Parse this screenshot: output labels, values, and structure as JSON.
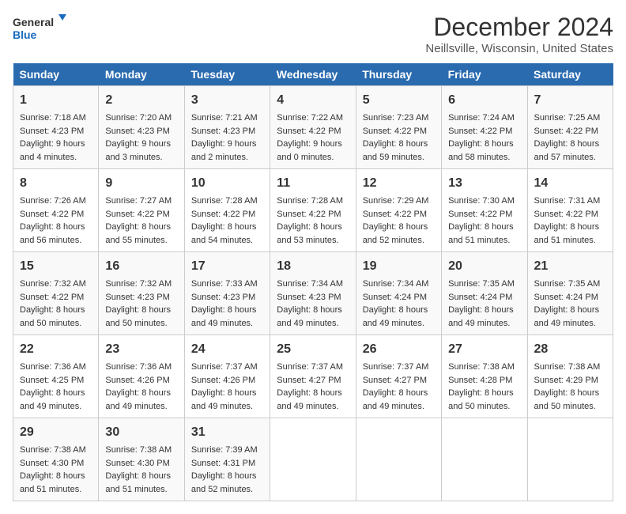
{
  "logo": {
    "line1": "General",
    "line2": "Blue"
  },
  "title": "December 2024",
  "subtitle": "Neillsville, Wisconsin, United States",
  "days_of_week": [
    "Sunday",
    "Monday",
    "Tuesday",
    "Wednesday",
    "Thursday",
    "Friday",
    "Saturday"
  ],
  "weeks": [
    [
      {
        "day": "1",
        "sunrise": "Sunrise: 7:18 AM",
        "sunset": "Sunset: 4:23 PM",
        "daylight": "Daylight: 9 hours and 4 minutes."
      },
      {
        "day": "2",
        "sunrise": "Sunrise: 7:20 AM",
        "sunset": "Sunset: 4:23 PM",
        "daylight": "Daylight: 9 hours and 3 minutes."
      },
      {
        "day": "3",
        "sunrise": "Sunrise: 7:21 AM",
        "sunset": "Sunset: 4:23 PM",
        "daylight": "Daylight: 9 hours and 2 minutes."
      },
      {
        "day": "4",
        "sunrise": "Sunrise: 7:22 AM",
        "sunset": "Sunset: 4:22 PM",
        "daylight": "Daylight: 9 hours and 0 minutes."
      },
      {
        "day": "5",
        "sunrise": "Sunrise: 7:23 AM",
        "sunset": "Sunset: 4:22 PM",
        "daylight": "Daylight: 8 hours and 59 minutes."
      },
      {
        "day": "6",
        "sunrise": "Sunrise: 7:24 AM",
        "sunset": "Sunset: 4:22 PM",
        "daylight": "Daylight: 8 hours and 58 minutes."
      },
      {
        "day": "7",
        "sunrise": "Sunrise: 7:25 AM",
        "sunset": "Sunset: 4:22 PM",
        "daylight": "Daylight: 8 hours and 57 minutes."
      }
    ],
    [
      {
        "day": "8",
        "sunrise": "Sunrise: 7:26 AM",
        "sunset": "Sunset: 4:22 PM",
        "daylight": "Daylight: 8 hours and 56 minutes."
      },
      {
        "day": "9",
        "sunrise": "Sunrise: 7:27 AM",
        "sunset": "Sunset: 4:22 PM",
        "daylight": "Daylight: 8 hours and 55 minutes."
      },
      {
        "day": "10",
        "sunrise": "Sunrise: 7:28 AM",
        "sunset": "Sunset: 4:22 PM",
        "daylight": "Daylight: 8 hours and 54 minutes."
      },
      {
        "day": "11",
        "sunrise": "Sunrise: 7:28 AM",
        "sunset": "Sunset: 4:22 PM",
        "daylight": "Daylight: 8 hours and 53 minutes."
      },
      {
        "day": "12",
        "sunrise": "Sunrise: 7:29 AM",
        "sunset": "Sunset: 4:22 PM",
        "daylight": "Daylight: 8 hours and 52 minutes."
      },
      {
        "day": "13",
        "sunrise": "Sunrise: 7:30 AM",
        "sunset": "Sunset: 4:22 PM",
        "daylight": "Daylight: 8 hours and 51 minutes."
      },
      {
        "day": "14",
        "sunrise": "Sunrise: 7:31 AM",
        "sunset": "Sunset: 4:22 PM",
        "daylight": "Daylight: 8 hours and 51 minutes."
      }
    ],
    [
      {
        "day": "15",
        "sunrise": "Sunrise: 7:32 AM",
        "sunset": "Sunset: 4:22 PM",
        "daylight": "Daylight: 8 hours and 50 minutes."
      },
      {
        "day": "16",
        "sunrise": "Sunrise: 7:32 AM",
        "sunset": "Sunset: 4:23 PM",
        "daylight": "Daylight: 8 hours and 50 minutes."
      },
      {
        "day": "17",
        "sunrise": "Sunrise: 7:33 AM",
        "sunset": "Sunset: 4:23 PM",
        "daylight": "Daylight: 8 hours and 49 minutes."
      },
      {
        "day": "18",
        "sunrise": "Sunrise: 7:34 AM",
        "sunset": "Sunset: 4:23 PM",
        "daylight": "Daylight: 8 hours and 49 minutes."
      },
      {
        "day": "19",
        "sunrise": "Sunrise: 7:34 AM",
        "sunset": "Sunset: 4:24 PM",
        "daylight": "Daylight: 8 hours and 49 minutes."
      },
      {
        "day": "20",
        "sunrise": "Sunrise: 7:35 AM",
        "sunset": "Sunset: 4:24 PM",
        "daylight": "Daylight: 8 hours and 49 minutes."
      },
      {
        "day": "21",
        "sunrise": "Sunrise: 7:35 AM",
        "sunset": "Sunset: 4:24 PM",
        "daylight": "Daylight: 8 hours and 49 minutes."
      }
    ],
    [
      {
        "day": "22",
        "sunrise": "Sunrise: 7:36 AM",
        "sunset": "Sunset: 4:25 PM",
        "daylight": "Daylight: 8 hours and 49 minutes."
      },
      {
        "day": "23",
        "sunrise": "Sunrise: 7:36 AM",
        "sunset": "Sunset: 4:26 PM",
        "daylight": "Daylight: 8 hours and 49 minutes."
      },
      {
        "day": "24",
        "sunrise": "Sunrise: 7:37 AM",
        "sunset": "Sunset: 4:26 PM",
        "daylight": "Daylight: 8 hours and 49 minutes."
      },
      {
        "day": "25",
        "sunrise": "Sunrise: 7:37 AM",
        "sunset": "Sunset: 4:27 PM",
        "daylight": "Daylight: 8 hours and 49 minutes."
      },
      {
        "day": "26",
        "sunrise": "Sunrise: 7:37 AM",
        "sunset": "Sunset: 4:27 PM",
        "daylight": "Daylight: 8 hours and 49 minutes."
      },
      {
        "day": "27",
        "sunrise": "Sunrise: 7:38 AM",
        "sunset": "Sunset: 4:28 PM",
        "daylight": "Daylight: 8 hours and 50 minutes."
      },
      {
        "day": "28",
        "sunrise": "Sunrise: 7:38 AM",
        "sunset": "Sunset: 4:29 PM",
        "daylight": "Daylight: 8 hours and 50 minutes."
      }
    ],
    [
      {
        "day": "29",
        "sunrise": "Sunrise: 7:38 AM",
        "sunset": "Sunset: 4:30 PM",
        "daylight": "Daylight: 8 hours and 51 minutes."
      },
      {
        "day": "30",
        "sunrise": "Sunrise: 7:38 AM",
        "sunset": "Sunset: 4:30 PM",
        "daylight": "Daylight: 8 hours and 51 minutes."
      },
      {
        "day": "31",
        "sunrise": "Sunrise: 7:39 AM",
        "sunset": "Sunset: 4:31 PM",
        "daylight": "Daylight: 8 hours and 52 minutes."
      },
      null,
      null,
      null,
      null
    ]
  ]
}
